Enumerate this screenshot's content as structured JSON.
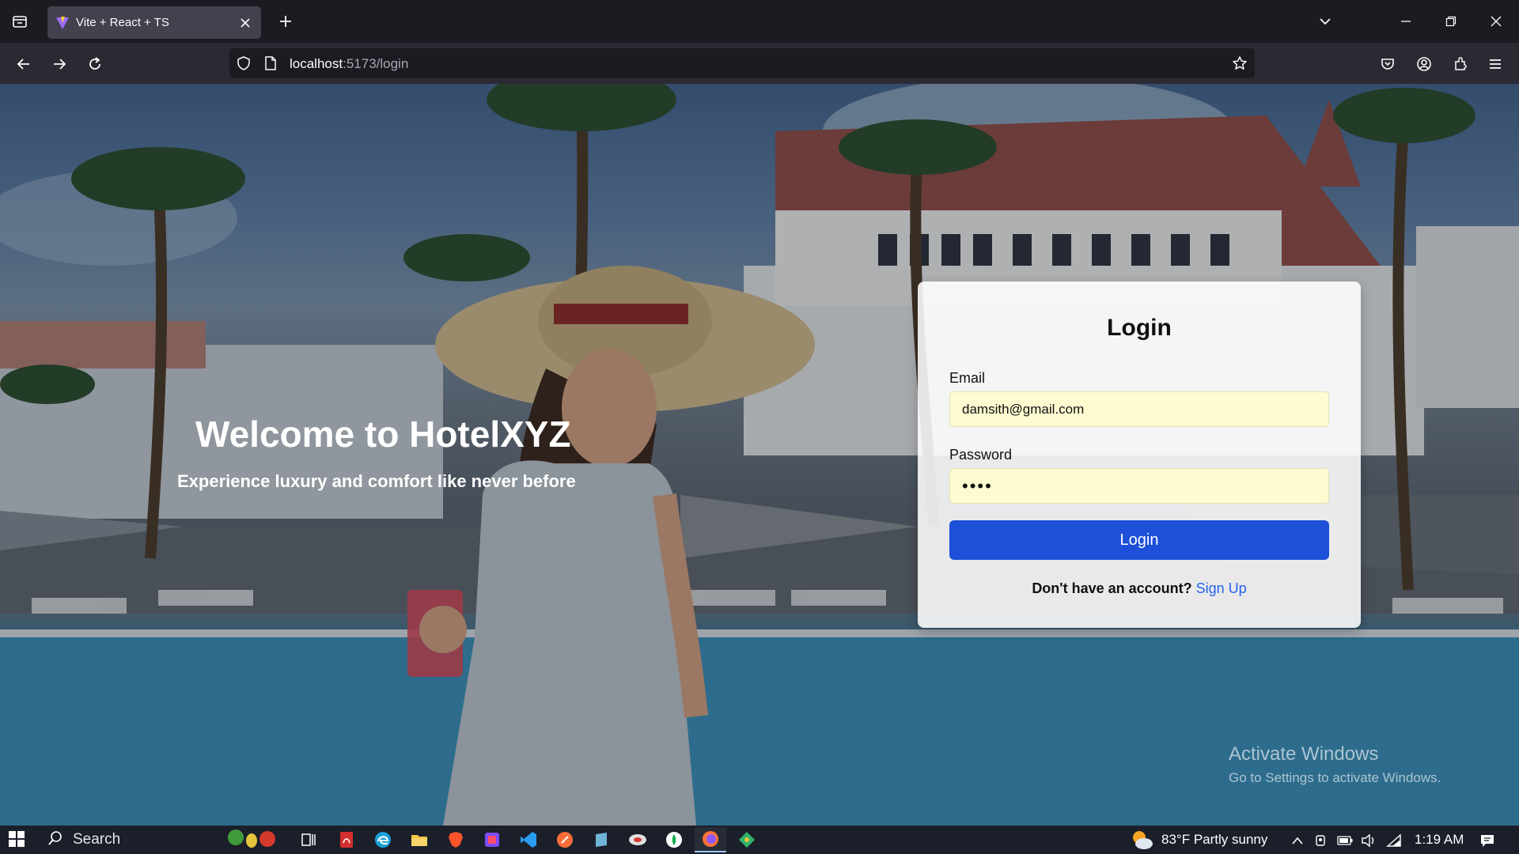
{
  "browser": {
    "tab": {
      "title": "Vite + React + TS"
    },
    "url": {
      "host": "localhost",
      "rest": ":5173/login"
    }
  },
  "hero": {
    "title": "Welcome to HotelXYZ",
    "subtitle": "Experience luxury and comfort like never before"
  },
  "login": {
    "title": "Login",
    "email_label": "Email",
    "email_value": "damsith@gmail.com",
    "password_label": "Password",
    "password_value": "1234",
    "submit_label": "Login",
    "signup_prompt": "Don't have an account?",
    "signup_link": "Sign Up"
  },
  "watermark": {
    "title": "Activate Windows",
    "subtitle": "Go to Settings to activate Windows."
  },
  "taskbar": {
    "search_label": "Search",
    "weather": "83°F  Partly sunny",
    "clock": "1:19 AM"
  },
  "colors": {
    "primary_button": "#1d4fd8",
    "link": "#2563eb",
    "input_bg": "#fefbd0"
  }
}
